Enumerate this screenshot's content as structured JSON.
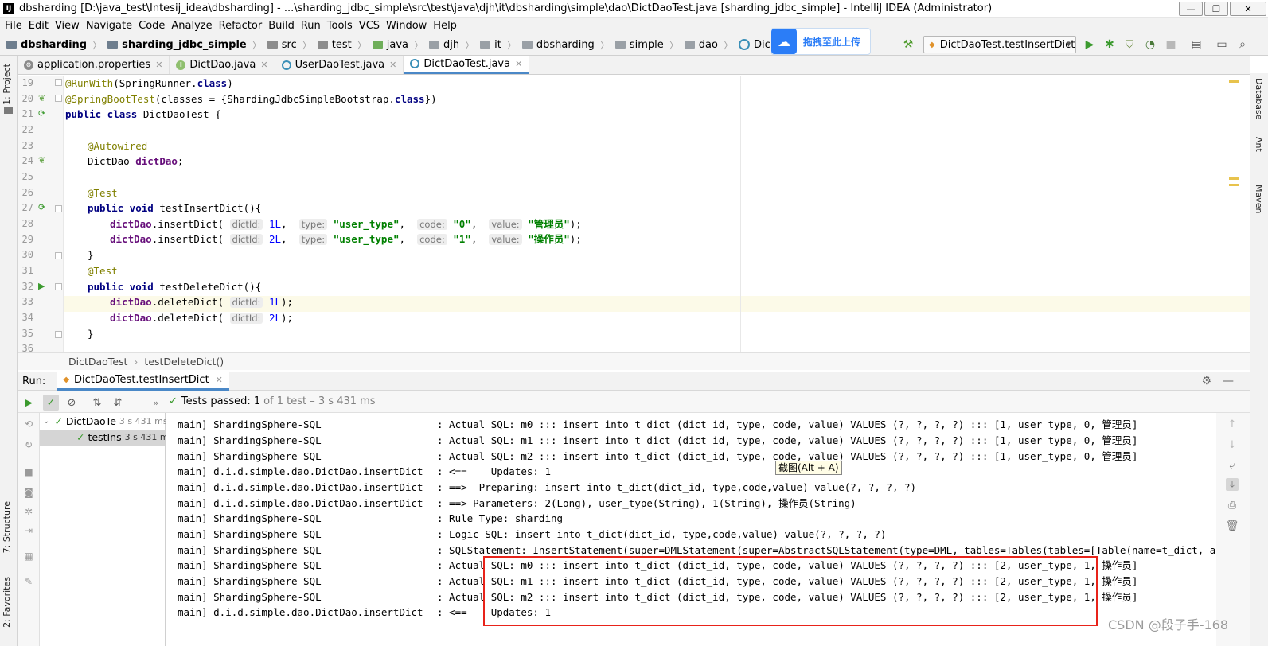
{
  "window": {
    "app_icon": "IJ",
    "title": "dbsharding [D:\\java_test\\Intesij_idea\\dbsharding] - ...\\sharding_jdbc_simple\\src\\test\\java\\djh\\it\\dbsharding\\simple\\dao\\DictDaoTest.java [sharding_jdbc_simple] - IntelliJ IDEA (Administrator)",
    "minimize": "—",
    "restore": "❐",
    "close": "✕"
  },
  "menu": [
    "File",
    "Edit",
    "View",
    "Navigate",
    "Code",
    "Analyze",
    "Refactor",
    "Build",
    "Run",
    "Tools",
    "VCS",
    "Window",
    "Help"
  ],
  "breadcrumb": [
    "dbsharding",
    "sharding_jdbc_simple",
    "src",
    "test",
    "java",
    "djh",
    "it",
    "dbsharding",
    "simple",
    "dao",
    "DictDaoTest"
  ],
  "baidu_upload": {
    "label": "拖拽至此上传"
  },
  "run_config": {
    "label": "DictDaoTest.testInsertDict"
  },
  "left_stripe": {
    "project": "1: Project",
    "structure": "7: Structure",
    "favorites": "2: Favorites"
  },
  "right_stripe": {
    "database": "Database",
    "ant": "Ant",
    "maven": "Maven"
  },
  "editor_tabs": [
    {
      "label": "application.properties",
      "icon": "properties-icon",
      "active": false
    },
    {
      "label": "DictDao.java",
      "icon": "interface-icon",
      "active": false
    },
    {
      "label": "UserDaoTest.java",
      "icon": "class-icon",
      "active": false
    },
    {
      "label": "DictDaoTest.java",
      "icon": "class-icon",
      "active": true
    }
  ],
  "line_numbers": [
    "19",
    "20",
    "21",
    "22",
    "23",
    "24",
    "25",
    "26",
    "27",
    "28",
    "29",
    "30",
    "31",
    "32",
    "33",
    "34",
    "35",
    "36"
  ],
  "code": {
    "l19_ann": "@RunWith",
    "l19_a": "(SpringRunner.",
    "l19_kw": "class",
    "l19_b": ")",
    "l20_ann": "@SpringBootTest",
    "l20_a": "(classes = {ShardingJdbcSimpleBootstrap.",
    "l20_kw": "class",
    "l20_b": "})",
    "l21_kw": "public class",
    "l21_a": " DictDaoTest {",
    "l23_ann": "@Autowired",
    "l24_a": "DictDao ",
    "l24_fld": "dictDao",
    "l24_b": ";",
    "l26_ann": "@Test",
    "l27_kw": "public void",
    "l27_a": " testInsertDict(){",
    "l28_fld": "dictDao",
    "l28_a": ".insertDict(",
    "l28_h1": "dictId:",
    "l28_n1": "1L",
    "l28_h2": "type:",
    "l28_s2": "\"user_type\"",
    "l28_h3": "code:",
    "l28_s3": "\"0\"",
    "l28_h4": "value:",
    "l28_s4": "\"管理员\"",
    "l28_end": ");",
    "l29_fld": "dictDao",
    "l29_a": ".insertDict(",
    "l29_h1": "dictId:",
    "l29_n1": "2L",
    "l29_h2": "type:",
    "l29_s2": "\"user_type\"",
    "l29_h3": "code:",
    "l29_s3": "\"1\"",
    "l29_h4": "value:",
    "l29_s4": "\"操作员\"",
    "l29_end": ");",
    "l30_a": "}",
    "l31_ann": "@Test",
    "l32_kw": "public void",
    "l32_a": " testDeleteDict(){",
    "l33_fld": "dictDao",
    "l33_a": ".deleteDict(",
    "l33_h1": "dictId:",
    "l33_n1": "1L",
    "l33_end": ");",
    "l34_fld": "dictDao",
    "l34_a": ".deleteDict(",
    "l34_h1": "dictId:",
    "l34_n1": "2L",
    "l34_end": ");",
    "l35_a": "}"
  },
  "editor_breadcrumb": [
    "DictDaoTest",
    "testDeleteDict()"
  ],
  "run_panel": {
    "label": "Run:",
    "tab": "DictDaoTest.testInsertDict",
    "tests_passed_label": "Tests passed:",
    "tests_passed_count": "1",
    "tests_passed_detail": "of 1 test – 3 s 431 ms"
  },
  "test_tree": [
    {
      "label": "DictDaoTe",
      "time": "3 s 431 ms"
    },
    {
      "label": "testIns",
      "time": "3 s 431 ms"
    }
  ],
  "console_lines": [
    {
      "src": "main] ShardingSphere-SQL",
      "msg": ": Actual SQL: m0 ::: insert into t_dict (dict_id, type, code, value) VALUES (?, ?, ?, ?) ::: [1, user_type, 0, 管理员]"
    },
    {
      "src": "main] ShardingSphere-SQL",
      "msg": ": Actual SQL: m1 ::: insert into t_dict (dict_id, type, code, value) VALUES (?, ?, ?, ?) ::: [1, user_type, 0, 管理员]"
    },
    {
      "src": "main] ShardingSphere-SQL",
      "msg": ": Actual SQL: m2 ::: insert into t_dict (dict_id, type, code, value) VALUES (?, ?, ?, ?) ::: [1, user_type, 0, 管理员]"
    },
    {
      "src": "main] d.i.d.simple.dao.DictDao.insertDict",
      "msg": ": <==    Updates: 1"
    },
    {
      "src": "main] d.i.d.simple.dao.DictDao.insertDict",
      "msg": ": ==>  Preparing: insert into t_dict(dict_id, type,code,value) value(?, ?, ?, ?)"
    },
    {
      "src": "main] d.i.d.simple.dao.DictDao.insertDict",
      "msg": ": ==> Parameters: 2(Long), user_type(String), 1(String), 操作员(String)"
    },
    {
      "src": "main] ShardingSphere-SQL",
      "msg": ": Rule Type: sharding"
    },
    {
      "src": "main] ShardingSphere-SQL",
      "msg": ": Logic SQL: insert into t_dict(dict_id, type,code,value) value(?, ?, ?, ?)"
    },
    {
      "src": "main] ShardingSphere-SQL",
      "msg": ": SQLStatement: InsertStatement(super=DMLStatement(super=AbstractSQLStatement(type=DML, tables=Tables(tables=[Table(name=t_dict, alias=Optiona"
    },
    {
      "src": "main] ShardingSphere-SQL",
      "msg": ": Actual SQL: m0 ::: insert into t_dict (dict_id, type, code, value) VALUES (?, ?, ?, ?) ::: [2, user_type, 1, 操作员]"
    },
    {
      "src": "main] ShardingSphere-SQL",
      "msg": ": Actual SQL: m1 ::: insert into t_dict (dict_id, type, code, value) VALUES (?, ?, ?, ?) ::: [2, user_type, 1, 操作员]"
    },
    {
      "src": "main] ShardingSphere-SQL",
      "msg": ": Actual SQL: m2 ::: insert into t_dict (dict_id, type, code, value) VALUES (?, ?, ?, ?) ::: [2, user_type, 1, 操作员]"
    },
    {
      "src": "main] d.i.d.simple.dao.DictDao.insertDict",
      "msg": ": <==    Updates: 1"
    }
  ],
  "tooltip": "截图(Alt + A)",
  "watermark": "CSDN @段子手-168",
  "colors": {
    "accent": "#4a88c7",
    "pass": "#3b9a2e",
    "highlight_box": "#e8231a"
  }
}
